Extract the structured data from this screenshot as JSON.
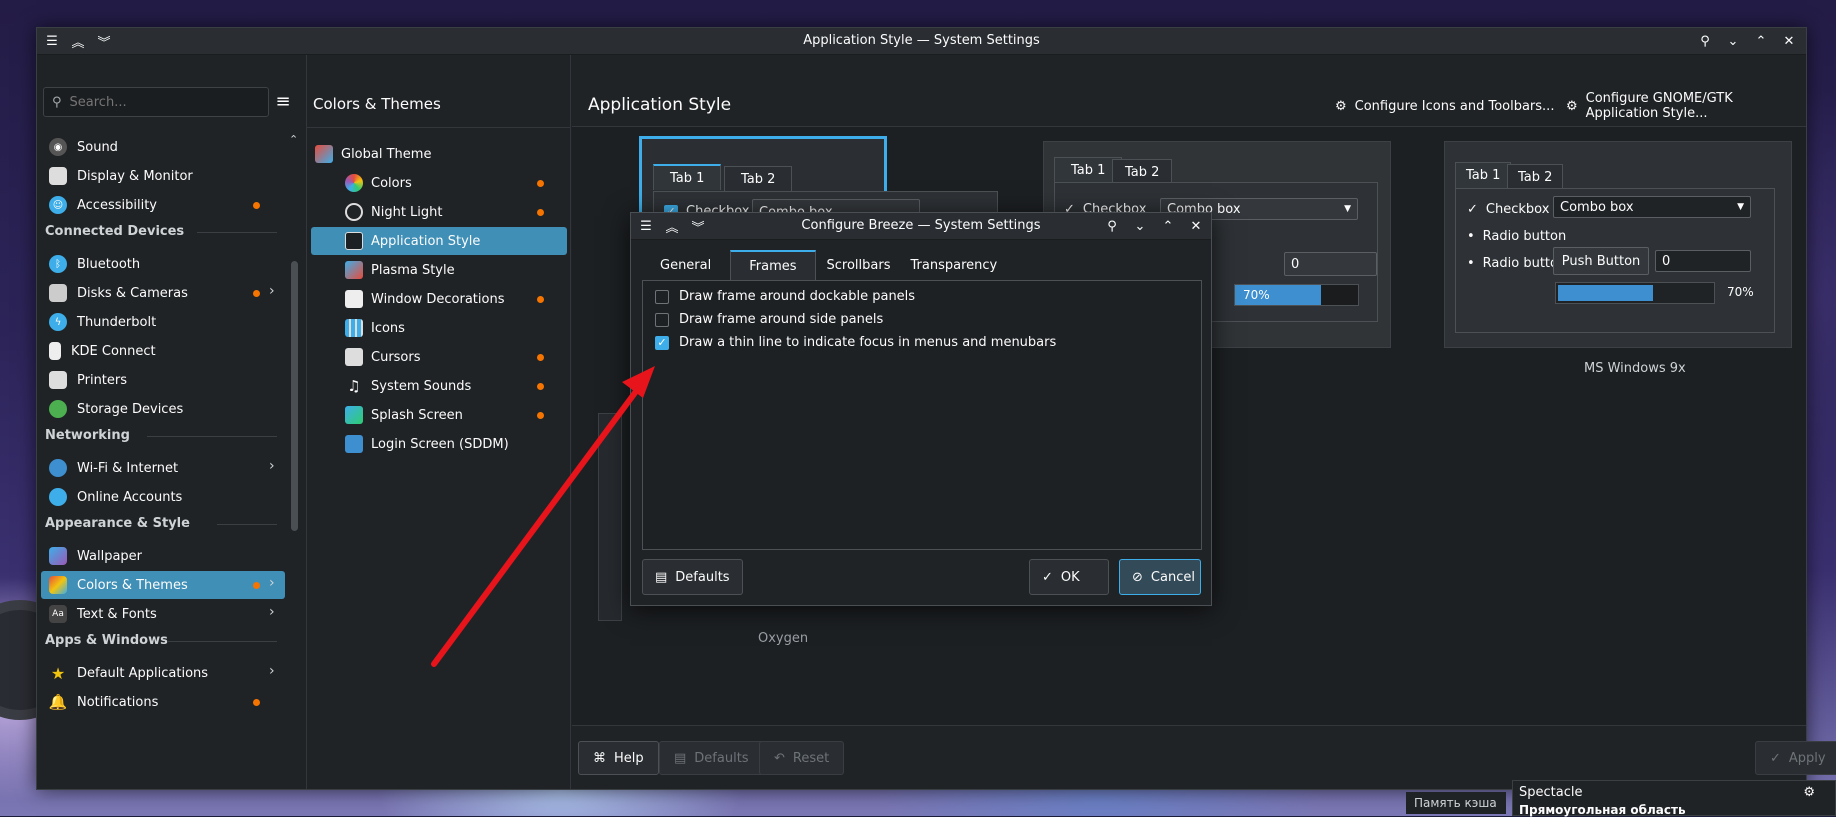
{
  "window": {
    "title": "Application Style — System Settings"
  },
  "search": {
    "placeholder": "Search..."
  },
  "sidebar": {
    "items": [
      {
        "label": "Sound",
        "icon": "speaker-icon"
      },
      {
        "label": "Display & Monitor",
        "icon": "monitor-icon"
      },
      {
        "label": "Accessibility",
        "icon": "accessibility-icon"
      },
      {
        "label": "Bluetooth",
        "icon": "bluetooth-icon"
      },
      {
        "label": "Disks & Cameras",
        "icon": "disk-icon"
      },
      {
        "label": "Thunderbolt",
        "icon": "thunderbolt-icon"
      },
      {
        "label": "KDE Connect",
        "icon": "phone-icon"
      },
      {
        "label": "Printers",
        "icon": "printer-icon"
      },
      {
        "label": "Storage Devices",
        "icon": "storage-icon"
      },
      {
        "label": "Wi-Fi & Internet",
        "icon": "globe-icon"
      },
      {
        "label": "Online Accounts",
        "icon": "accounts-icon"
      },
      {
        "label": "Wallpaper",
        "icon": "wallpaper-icon"
      },
      {
        "label": "Colors & Themes",
        "icon": "palette-icon"
      },
      {
        "label": "Text & Fonts",
        "icon": "font-icon"
      },
      {
        "label": "Default Applications",
        "icon": "star-icon"
      },
      {
        "label": "Notifications",
        "icon": "bell-icon"
      }
    ],
    "headers": [
      "Connected Devices",
      "Networking",
      "Appearance & Style",
      "Apps & Windows"
    ]
  },
  "col2": {
    "title": "Colors & Themes",
    "items": [
      {
        "label": "Global Theme"
      },
      {
        "label": "Colors"
      },
      {
        "label": "Night Light"
      },
      {
        "label": "Application Style"
      },
      {
        "label": "Plasma Style"
      },
      {
        "label": "Window Decorations"
      },
      {
        "label": "Icons"
      },
      {
        "label": "Cursors"
      },
      {
        "label": "System Sounds"
      },
      {
        "label": "Splash Screen"
      },
      {
        "label": "Login Screen (SDDM)"
      }
    ]
  },
  "main": {
    "title": "Application Style",
    "configure_icons": "Configure Icons and Toolbars...",
    "configure_gtk": "Configure GNOME/GTK Application Style...",
    "preview": {
      "tab1": "Tab 1",
      "tab2": "Tab 2",
      "checkbox": "Checkbox",
      "combo": "Combo box",
      "radio": "Radio button",
      "push": "Push Button",
      "spin": "0",
      "progress": "70%",
      "label_oxygen": "Oxygen",
      "label_ms": "MS Windows 9x"
    }
  },
  "footer": {
    "help": "Help",
    "defaults": "Defaults",
    "reset": "Reset",
    "apply": "Apply"
  },
  "dialog": {
    "title": "Configure Breeze — System Settings",
    "tabs": [
      "General",
      "Frames",
      "Scrollbars",
      "Transparency"
    ],
    "options": [
      {
        "label": "Draw frame around dockable panels",
        "checked": false
      },
      {
        "label": "Draw frame around side panels",
        "checked": false
      },
      {
        "label": "Draw a thin line to indicate focus in menus and menubars",
        "checked": true
      }
    ],
    "defaults": "Defaults",
    "ok": "OK",
    "cancel": "Cancel"
  },
  "taskbar": {
    "spectacle": "Spectacle",
    "cache": "Память кэша",
    "region": "Прямоугольная область"
  },
  "colors": {
    "accent": "#3daee9",
    "selection": "#3f8fb7",
    "badge": "#f67400",
    "arrow": "#e8141b"
  }
}
